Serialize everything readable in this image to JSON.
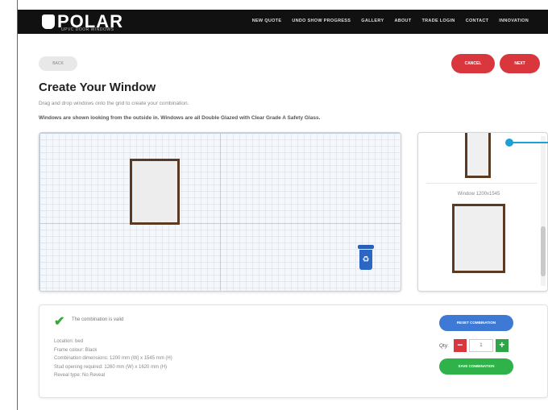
{
  "header": {
    "brand": "POLAR",
    "tagline": "UPVC DOOR WINDOWS",
    "nav": [
      "NEW QUOTE",
      "UNDO SHOW PROGRESS",
      "GALLERY",
      "ABOUT",
      "TRADE LOGIN",
      "CONTACT",
      "INNOVATION"
    ]
  },
  "actions": {
    "back": "BACK",
    "cancel": "CANCEL",
    "next": "NEXT"
  },
  "page": {
    "title": "Create Your Window",
    "subtitle": "Drag and drop windows onto the grid to create your combination.",
    "note": "Windows are shown looking from the outside in. Windows are all Double Glazed with Clear Grade A Safety Glass."
  },
  "palette": {
    "window_label": "Window 1200x1545"
  },
  "summary": {
    "status": "The combination is valid",
    "location": "Location: bed",
    "frame_colour": "Frame colour: Black",
    "dimensions": "Combination dimensions: 1200 mm (W) x 1545 mm (H)",
    "stud_opening": "Stud opening required: 1260 mm (W) x 1620 mm (H)",
    "reveal": "Reveal type: No Reveal",
    "reset_button": "RESET COMBINATION",
    "qty_label": "Qty:",
    "qty_value": "1",
    "save_button": "SAVE COMBINATION"
  },
  "icons": {
    "recycle": "recycle-bin-icon",
    "check": "check-icon"
  },
  "colors": {
    "accent_red": "#d9373d",
    "accent_blue": "#3f79d6",
    "accent_green": "#2fb24a",
    "frame_brown": "#5a3a22"
  }
}
